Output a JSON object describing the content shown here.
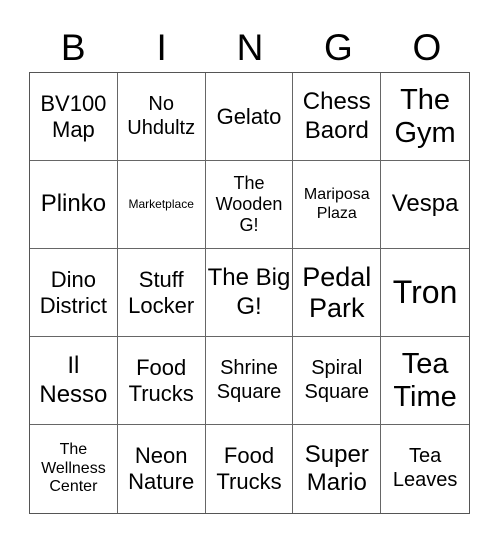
{
  "header": [
    "B",
    "I",
    "N",
    "G",
    "O"
  ],
  "cells": [
    "BV100 Map",
    "No Uhdultz",
    "Gelato",
    "Chess Baord",
    "The Gym",
    "Plinko",
    "Marketplace",
    "The Wooden G!",
    "Mariposa Plaza",
    "Vespa",
    "Dino District",
    "Stuff Locker",
    "The Big G!",
    "Pedal Park",
    "Tron",
    "Il Nesso",
    "Food Trucks",
    "Shrine Square",
    "Spiral Square",
    "Tea Time",
    "The Wellness Center",
    "Neon Nature",
    "Food Trucks",
    "Super Mario",
    "Tea Leaves"
  ]
}
